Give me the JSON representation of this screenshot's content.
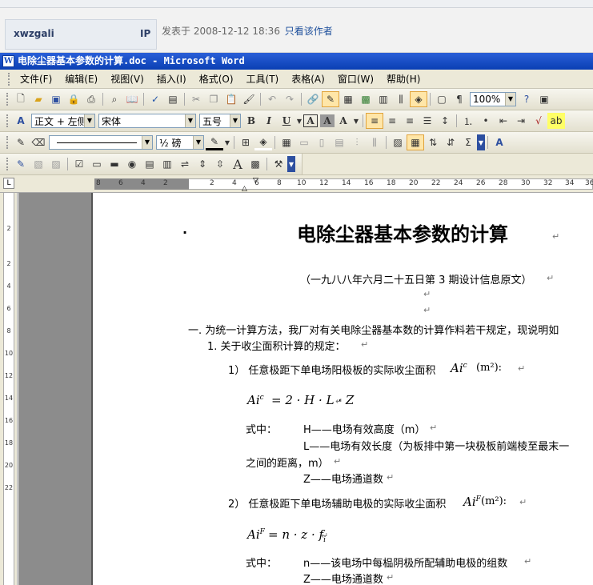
{
  "forum": {
    "username": "xwzgali",
    "ip_label": "IP",
    "posted_text": "发表于  2008-12-12 18:36",
    "only_author_link": "只看该作者"
  },
  "window": {
    "title": "电除尘器基本参数的计算.doc - Microsoft Word",
    "app_icon": "W"
  },
  "menu": [
    "文件(F)",
    "编辑(E)",
    "视图(V)",
    "插入(I)",
    "格式(O)",
    "工具(T)",
    "表格(A)",
    "窗口(W)",
    "帮助(H)"
  ],
  "toolbar_standard": {
    "zoom": "100%"
  },
  "toolbar_format": {
    "style": "正文 + 左侧",
    "font": "宋体",
    "size": "五号",
    "bold": "B",
    "italic": "I",
    "underline": "U",
    "char_border": "A",
    "char_shade": "A",
    "dropdown_char": "A"
  },
  "toolbar_draw": {
    "line_weight": "½ 磅"
  },
  "ruler": {
    "tab_selector": "L",
    "numbers": [
      "8",
      "6",
      "4",
      "2",
      "2",
      "4",
      "6",
      "8",
      "10",
      "12",
      "14",
      "16",
      "18",
      "20",
      "22",
      "24",
      "26",
      "28",
      "30",
      "32",
      "34",
      "36"
    ],
    "vertical_numbers": [
      "2",
      "2",
      "4",
      "6",
      "8",
      "10",
      "12",
      "14",
      "16",
      "18",
      "20",
      "22"
    ]
  },
  "document": {
    "bullet": "·",
    "title": "电除尘器基本参数的计算",
    "subtitle": "（一九八八年六月二十五日第 3 期设计信息原文）",
    "para_1": "一.   为统一计算方法，我厂对有关电除尘器基本数的计算作料若干规定，现说明如",
    "para_1_1": "1.   关于收尘面积计算的规定：",
    "item_1": "1）  任意极距下单电场阳极板的实际收尘面积",
    "item_1_sym": "Ai",
    "item_1_sup": "c",
    "item_1_unit": "(m²):",
    "formula_1": "= 2 · H · L · Z",
    "where": "式中：",
    "def_H": "H——电场有效高度（m）",
    "def_L": "L——电场有效长度（为板排中第一块极板前端棱至最末一",
    "def_L2": "之间的距离，m）",
    "def_Z": "Z——电场通道数",
    "item_2": "2）  任意极距下单电场辅助电极的实际收尘面积",
    "item_2_sup": "F",
    "item_2_unit": "(m²):",
    "formula_2": "= n · z · f",
    "formula_2_sub": "i",
    "where_2": "式中：",
    "def_n": "n——该电场中每榀阴极所配辅助电极的组数",
    "def_Z2": "Z——电场通道数"
  }
}
